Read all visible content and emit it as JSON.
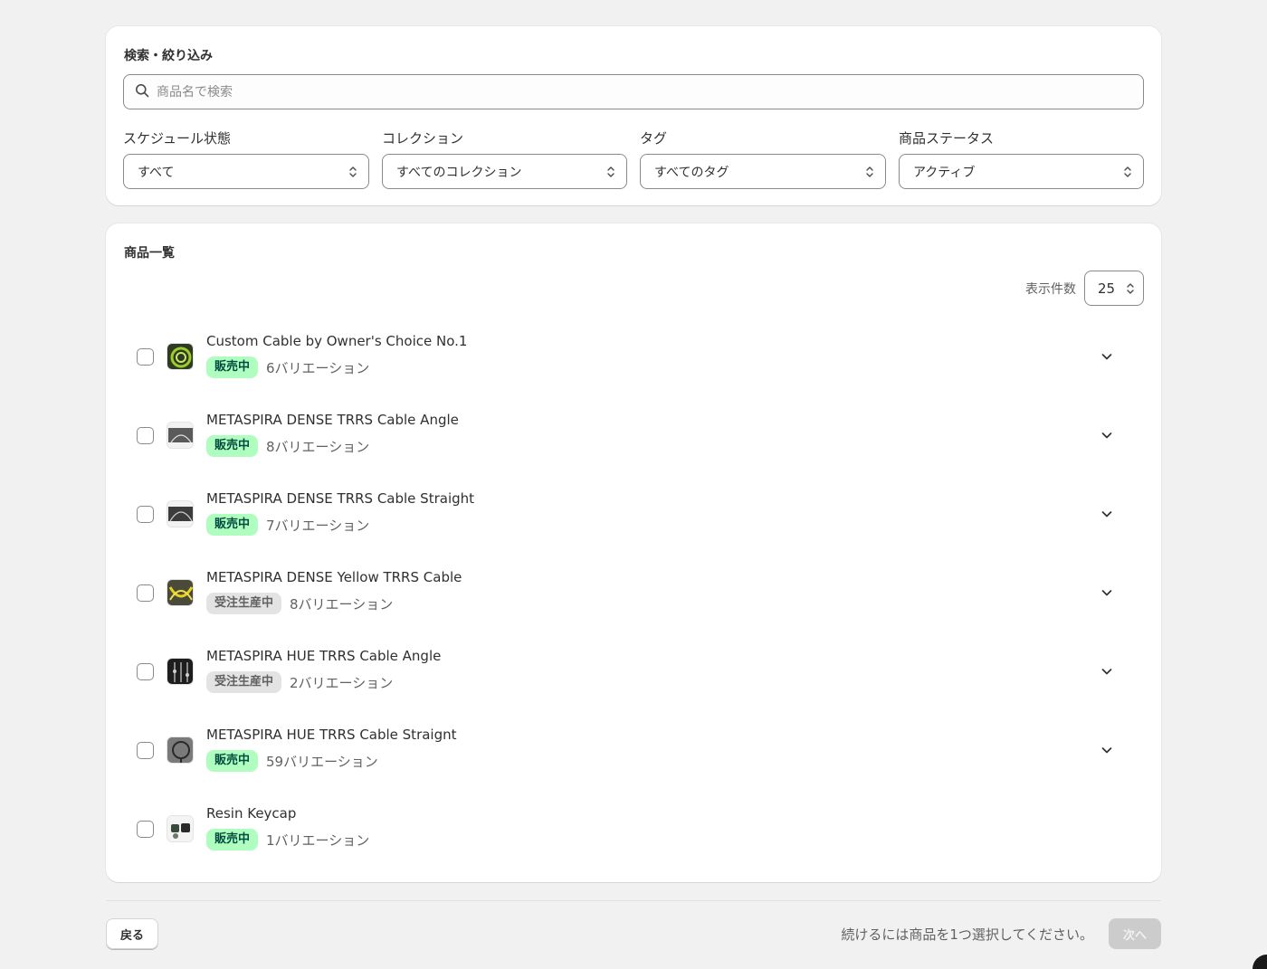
{
  "filter": {
    "title": "検索・絞り込み",
    "search_placeholder": "商品名で検索",
    "search_value": "",
    "groups": [
      {
        "label": "スケジュール状態",
        "value": "すべて"
      },
      {
        "label": "コレクション",
        "value": "すべてのコレクション"
      },
      {
        "label": "タグ",
        "value": "すべてのタグ"
      },
      {
        "label": "商品ステータス",
        "value": "アクティブ"
      }
    ]
  },
  "list": {
    "title": "商品一覧",
    "per_page_label": "表示件数",
    "per_page_value": "25",
    "products": [
      {
        "name": "Custom Cable by Owner's Choice No.1",
        "status": "販売中",
        "variations": "6バリエーション"
      },
      {
        "name": "METASPIRA DENSE TRRS Cable Angle",
        "status": "販売中",
        "variations": "8バリエーション"
      },
      {
        "name": "METASPIRA DENSE TRRS Cable Straight",
        "status": "販売中",
        "variations": "7バリエーション"
      },
      {
        "name": "METASPIRA DENSE Yellow TRRS Cable",
        "status": "受注生産中",
        "variations": "8バリエーション"
      },
      {
        "name": "METASPIRA HUE TRRS Cable Angle",
        "status": "受注生産中",
        "variations": "2バリエーション"
      },
      {
        "name": "METASPIRA HUE TRRS Cable Straignt",
        "status": "販売中",
        "variations": "59バリエーション"
      },
      {
        "name": "Resin Keycap",
        "status": "販売中",
        "variations": "1バリエーション"
      }
    ]
  },
  "footer": {
    "back_label": "戻る",
    "hint": "続けるには商品を1つ選択してください。",
    "next_label": "次へ"
  },
  "colors": {
    "badge_active_bg": "#affebf",
    "badge_active_text": "#014b40",
    "badge_made_bg": "#e3e3e3",
    "page_bg": "#f1f1f1"
  }
}
